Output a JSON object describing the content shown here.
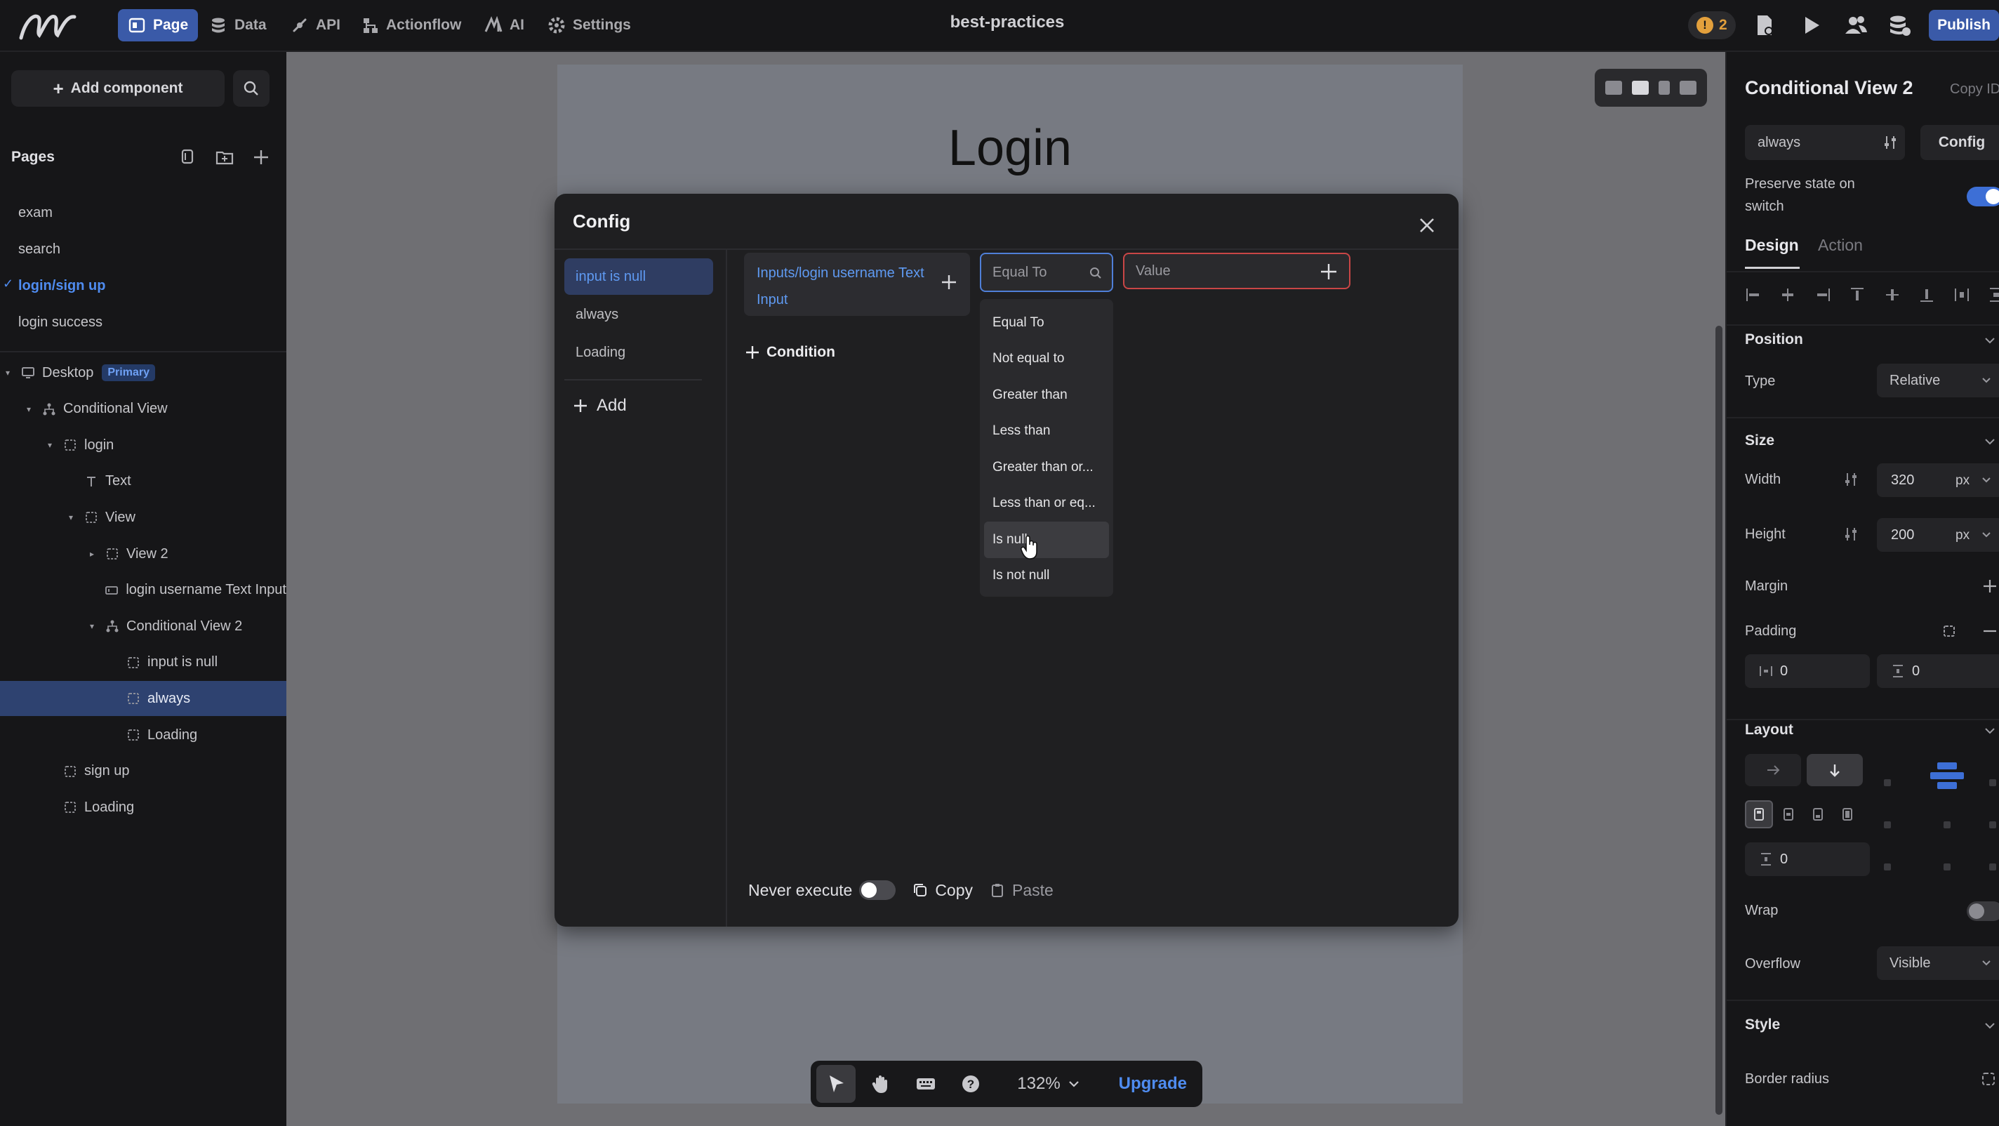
{
  "topbar": {
    "nav": [
      {
        "label": "Page",
        "icon": "page-icon",
        "active": true
      },
      {
        "label": "Data",
        "icon": "database-icon",
        "active": false
      },
      {
        "label": "API",
        "icon": "api-icon",
        "active": false
      },
      {
        "label": "Actionflow",
        "icon": "actionflow-icon",
        "active": false
      },
      {
        "label": "AI",
        "icon": "ai-icon",
        "active": false
      },
      {
        "label": "Settings",
        "icon": "gear-icon",
        "active": false
      }
    ],
    "project_title": "best-practices",
    "warning_count": "2",
    "publish_label": "Publish"
  },
  "left_panel": {
    "add_component_label": "Add component",
    "pages_header": "Pages",
    "pages": [
      {
        "label": "exam",
        "active": false
      },
      {
        "label": "search",
        "active": false
      },
      {
        "label": "login/sign up",
        "active": true
      },
      {
        "label": "login success",
        "active": false
      }
    ],
    "tree": [
      {
        "label": "Desktop",
        "badge": "Primary",
        "icon": "desktop-icon",
        "arrow": "▾",
        "level": 0
      },
      {
        "label": "Conditional View",
        "icon": "conditional-icon",
        "arrow": "▾",
        "level": 1
      },
      {
        "label": "login",
        "icon": "view-icon",
        "arrow": "▾",
        "level": 2
      },
      {
        "label": "Text",
        "icon": "text-icon",
        "arrow": "",
        "level": 3
      },
      {
        "label": "View",
        "icon": "view-icon",
        "arrow": "▾",
        "level": 3
      },
      {
        "label": "View 2",
        "icon": "view-icon",
        "arrow": "▸",
        "level": 4
      },
      {
        "label": "login username Text Input",
        "icon": "input-icon",
        "arrow": "",
        "level": 4
      },
      {
        "label": "Conditional View 2",
        "icon": "conditional-icon",
        "arrow": "▾",
        "level": 4
      },
      {
        "label": "input is null",
        "icon": "view-icon",
        "arrow": "",
        "level": 5
      },
      {
        "label": "always",
        "icon": "view-icon",
        "arrow": "",
        "level": 5,
        "selected": true
      },
      {
        "label": "Loading",
        "icon": "view-icon",
        "arrow": "",
        "level": 5
      },
      {
        "label": "sign up",
        "icon": "view-icon",
        "arrow": "",
        "level": 2
      },
      {
        "label": "Loading",
        "icon": "view-icon",
        "arrow": "",
        "level": 2
      }
    ]
  },
  "canvas": {
    "login_heading": "Login",
    "zoom": "132%",
    "upgrade_label": "Upgrade"
  },
  "config_dialog": {
    "title": "Config",
    "conditions": [
      {
        "label": "input is null",
        "active": true
      },
      {
        "label": "always",
        "active": false
      },
      {
        "label": "Loading",
        "active": false
      }
    ],
    "add_label": "Add",
    "field_value_line1": "Inputs/login username Text",
    "field_value_line2": "Input",
    "operator_placeholder": "Equal To",
    "value_placeholder": "Value",
    "add_condition_label": "Condition",
    "operators": [
      {
        "label": "Equal To",
        "hover": false
      },
      {
        "label": "Not equal to",
        "hover": false
      },
      {
        "label": "Greater than",
        "hover": false
      },
      {
        "label": "Less than",
        "hover": false
      },
      {
        "label": "Greater than or...",
        "hover": false
      },
      {
        "label": "Less than or eq...",
        "hover": false
      },
      {
        "label": "Is null",
        "hover": true
      },
      {
        "label": "Is not null",
        "hover": false
      }
    ],
    "never_execute_label": "Never execute",
    "never_execute_on": false,
    "copy_label": "Copy",
    "paste_label": "Paste"
  },
  "right_panel": {
    "title": "Conditional View 2",
    "copy_id_label": "Copy ID",
    "state_value": "always",
    "config_label": "Config",
    "preserve_label": "Preserve state on switch",
    "preserve_on": true,
    "tabs": [
      "Design",
      "Action"
    ],
    "position_header": "Position",
    "type_label": "Type",
    "type_value": "Relative",
    "size_header": "Size",
    "width_label": "Width",
    "width_value": "320",
    "width_unit": "px",
    "height_label": "Height",
    "height_value": "200",
    "height_unit": "px",
    "margin_label": "Margin",
    "padding_label": "Padding",
    "padding_h": "0",
    "padding_v": "0",
    "layout_header": "Layout",
    "gap_value": "0",
    "wrap_label": "Wrap",
    "wrap_on": false,
    "overflow_label": "Overflow",
    "overflow_value": "Visible",
    "style_header": "Style",
    "border_radius_label": "Border radius"
  },
  "colors": {
    "accent": "#3a5aa8",
    "link_blue": "#4f8cf0",
    "error_red": "#c94646",
    "warning": "#e3a03c"
  }
}
